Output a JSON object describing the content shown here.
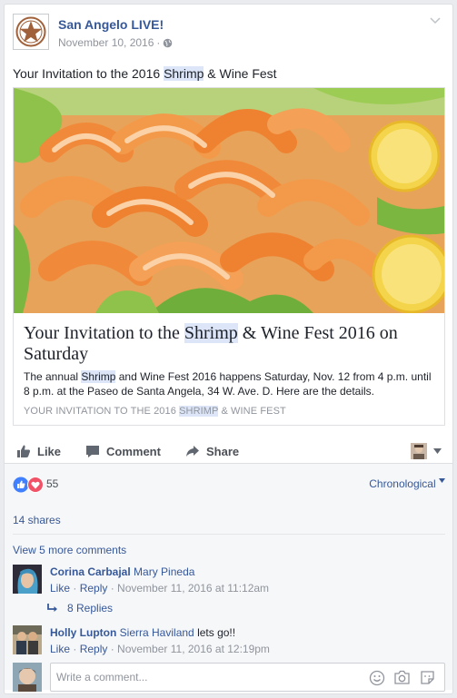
{
  "post": {
    "page_name": "San Angelo LIVE!",
    "date": "November 10, 2016",
    "date_sep": " · ",
    "text_before": "Your Invitation to the 2016 ",
    "text_highlight": "Shrimp",
    "text_after": " & Wine Fest",
    "privacy_icon": "globe-icon",
    "menu_icon": "chevron-down-icon"
  },
  "link": {
    "image_alt": "shrimp platter",
    "title_before": "Your Invitation to the ",
    "title_highlight": "Shrimp",
    "title_after": " & Wine Fest 2016 on Saturday",
    "desc_before": "The annual ",
    "desc_highlight": "Shrimp",
    "desc_after": " and Wine Fest 2016 happens Saturday, Nov. 12 from 4 p.m. until 8 p.m. at the Paseo de Santa Angela, 34 W. Ave. D. Here are the details.",
    "source_before": "YOUR INVITATION TO THE 2016 ",
    "source_highlight": "SHRIMP",
    "source_after": " & WINE FEST"
  },
  "actions": {
    "like": "Like",
    "comment": "Comment",
    "share": "Share"
  },
  "feedback": {
    "reaction_count": "55",
    "sort_label": "Chronological",
    "shares": "14 shares",
    "view_more": "View 5 more comments",
    "replies": "8 Replies",
    "write_placeholder": "Write a comment..."
  },
  "comments": [
    {
      "author": "Corina Carbajal",
      "tag": "Mary Pineda",
      "text": "",
      "like": "Like",
      "reply": "Reply",
      "dot": " · ",
      "time": "November 11, 2016 at 11:12am"
    },
    {
      "author": "Holly Lupton",
      "tag": "Sierra Haviland",
      "text": "lets go!!",
      "like": "Like",
      "reply": "Reply",
      "dot": " · ",
      "time": "November 11, 2016 at 12:19pm"
    }
  ],
  "colors": {
    "link_blue": "#365899",
    "meta_gray": "#90949c",
    "shrimp": "#f08a3a",
    "lettuce": "#7bb640",
    "lemon": "#f4d44a"
  }
}
